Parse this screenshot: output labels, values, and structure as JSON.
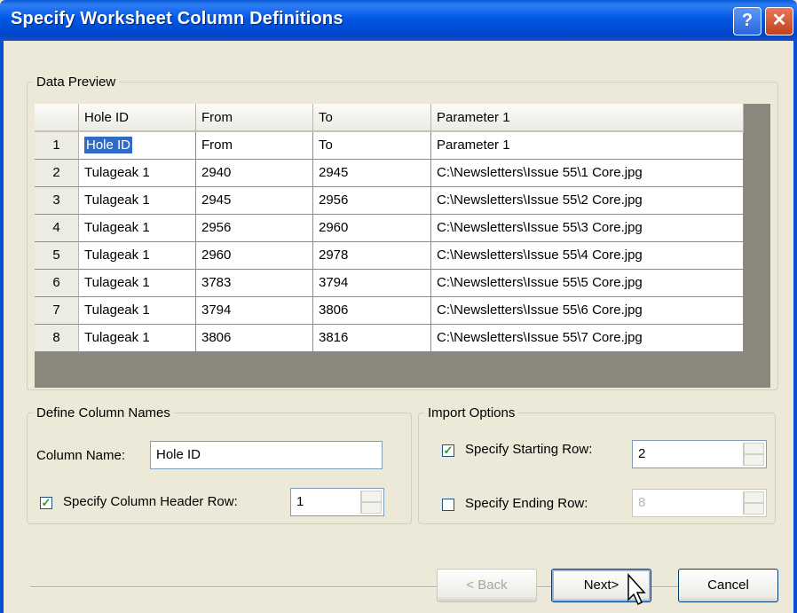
{
  "window": {
    "title": "Specify Worksheet Column Definitions",
    "help_glyph": "?",
    "close_glyph": "✕"
  },
  "data_preview": {
    "legend": "Data Preview",
    "columns": [
      "Hole ID",
      "From",
      "To",
      "Parameter 1"
    ],
    "rows": [
      {
        "num": "1",
        "cells": [
          "Hole ID",
          "From",
          "To",
          "Parameter 1"
        ]
      },
      {
        "num": "2",
        "cells": [
          "Tulageak 1",
          "2940",
          "2945",
          "C:\\Newsletters\\Issue 55\\1 Core.jpg"
        ]
      },
      {
        "num": "3",
        "cells": [
          "Tulageak 1",
          "2945",
          "2956",
          "C:\\Newsletters\\Issue 55\\2 Core.jpg"
        ]
      },
      {
        "num": "4",
        "cells": [
          "Tulageak 1",
          "2956",
          "2960",
          "C:\\Newsletters\\Issue 55\\3 Core.jpg"
        ]
      },
      {
        "num": "5",
        "cells": [
          "Tulageak 1",
          "2960",
          "2978",
          "C:\\Newsletters\\Issue 55\\4 Core.jpg"
        ]
      },
      {
        "num": "6",
        "cells": [
          "Tulageak 1",
          "3783",
          "3794",
          "C:\\Newsletters\\Issue 55\\5 Core.jpg"
        ]
      },
      {
        "num": "7",
        "cells": [
          "Tulageak 1",
          "3794",
          "3806",
          "C:\\Newsletters\\Issue 55\\6 Core.jpg"
        ]
      },
      {
        "num": "8",
        "cells": [
          "Tulageak 1",
          "3806",
          "3816",
          "C:\\Newsletters\\Issue 55\\7 Core.jpg"
        ]
      }
    ]
  },
  "define_columns": {
    "legend": "Define Column Names",
    "column_name_label": "Column Name:",
    "column_name_value": "Hole ID",
    "header_row_checked": true,
    "header_row_label": "Specify Column Header Row:",
    "header_row_value": "1"
  },
  "import_options": {
    "legend": "Import Options",
    "start_row_checked": true,
    "start_row_label": "Specify Starting Row:",
    "start_row_value": "2",
    "end_row_checked": false,
    "end_row_label": "Specify Ending Row:",
    "end_row_value": "8"
  },
  "buttons": {
    "back": "< Back",
    "next": "Next>",
    "cancel": "Cancel"
  },
  "colors": {
    "title_bar": "#0058e6",
    "selection": "#316ac5",
    "dialog_bg": "#ece9d8"
  }
}
